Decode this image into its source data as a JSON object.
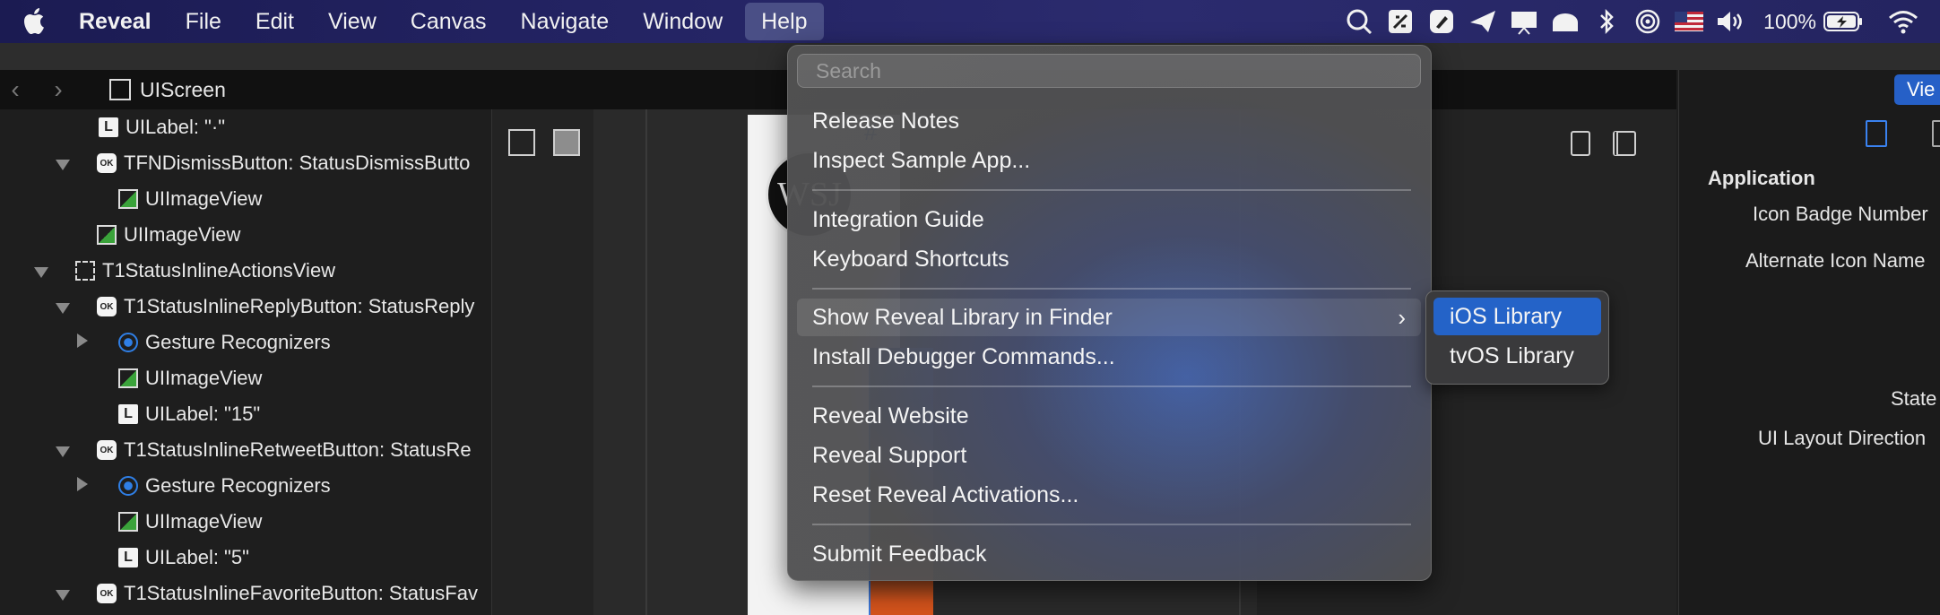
{
  "menubar": {
    "app_name": "Reveal",
    "items": [
      "File",
      "Edit",
      "View",
      "Canvas",
      "Navigate",
      "Window",
      "Help"
    ],
    "battery_percent": "100%",
    "status_icons": [
      "search-icon",
      "script-icon",
      "pen-icon",
      "paper-plane-icon",
      "presentation-icon",
      "cloud-icon",
      "bluetooth-icon",
      "airdrop-icon",
      "us-flag-icon",
      "volume-icon",
      "battery-icon",
      "wifi-icon"
    ]
  },
  "nav": {
    "current": "UIScreen"
  },
  "tree": [
    {
      "label": "UILabel: \"·\"",
      "icon": "L"
    },
    {
      "label": "TFNDismissButton: StatusDismissButto",
      "icon": "OK"
    },
    {
      "label": "UIImageView",
      "icon": "img"
    },
    {
      "label": "UIImageView",
      "icon": "img"
    },
    {
      "label": "T1StatusInlineActionsView",
      "icon": "dash"
    },
    {
      "label": "T1StatusInlineReplyButton: StatusReply",
      "icon": "OK"
    },
    {
      "label": "Gesture Recognizers",
      "icon": "gest"
    },
    {
      "label": "UIImageView",
      "icon": "img"
    },
    {
      "label": "UILabel: \"15\"",
      "icon": "L"
    },
    {
      "label": "T1StatusInlineRetweetButton: StatusRe",
      "icon": "OK"
    },
    {
      "label": "Gesture Recognizers",
      "icon": "gest"
    },
    {
      "label": "UIImageView",
      "icon": "img"
    },
    {
      "label": "UILabel: \"5\"",
      "icon": "L"
    },
    {
      "label": "T1StatusInlineFavoriteButton: StatusFav",
      "icon": "OK"
    }
  ],
  "canvas": {
    "logo_text": "WSJ",
    "hash": "#"
  },
  "inspector": {
    "view_button": "Vie",
    "section": "Application",
    "fields": [
      "Icon Badge Number",
      "Alternate Icon Name",
      "State",
      "UI Layout Direction"
    ]
  },
  "help_menu": {
    "search_placeholder": "Search",
    "items": {
      "release_notes": "Release Notes",
      "inspect_sample": "Inspect Sample App...",
      "integration_guide": "Integration Guide",
      "keyboard_shortcuts": "Keyboard Shortcuts",
      "show_library": "Show Reveal Library in Finder",
      "install_debugger": "Install Debugger Commands...",
      "website": "Reveal Website",
      "support": "Reveal Support",
      "reset_activations": "Reset Reveal Activations...",
      "submit_feedback": "Submit Feedback"
    }
  },
  "submenu": {
    "ios": "iOS Library",
    "tvos": "tvOS Library"
  }
}
